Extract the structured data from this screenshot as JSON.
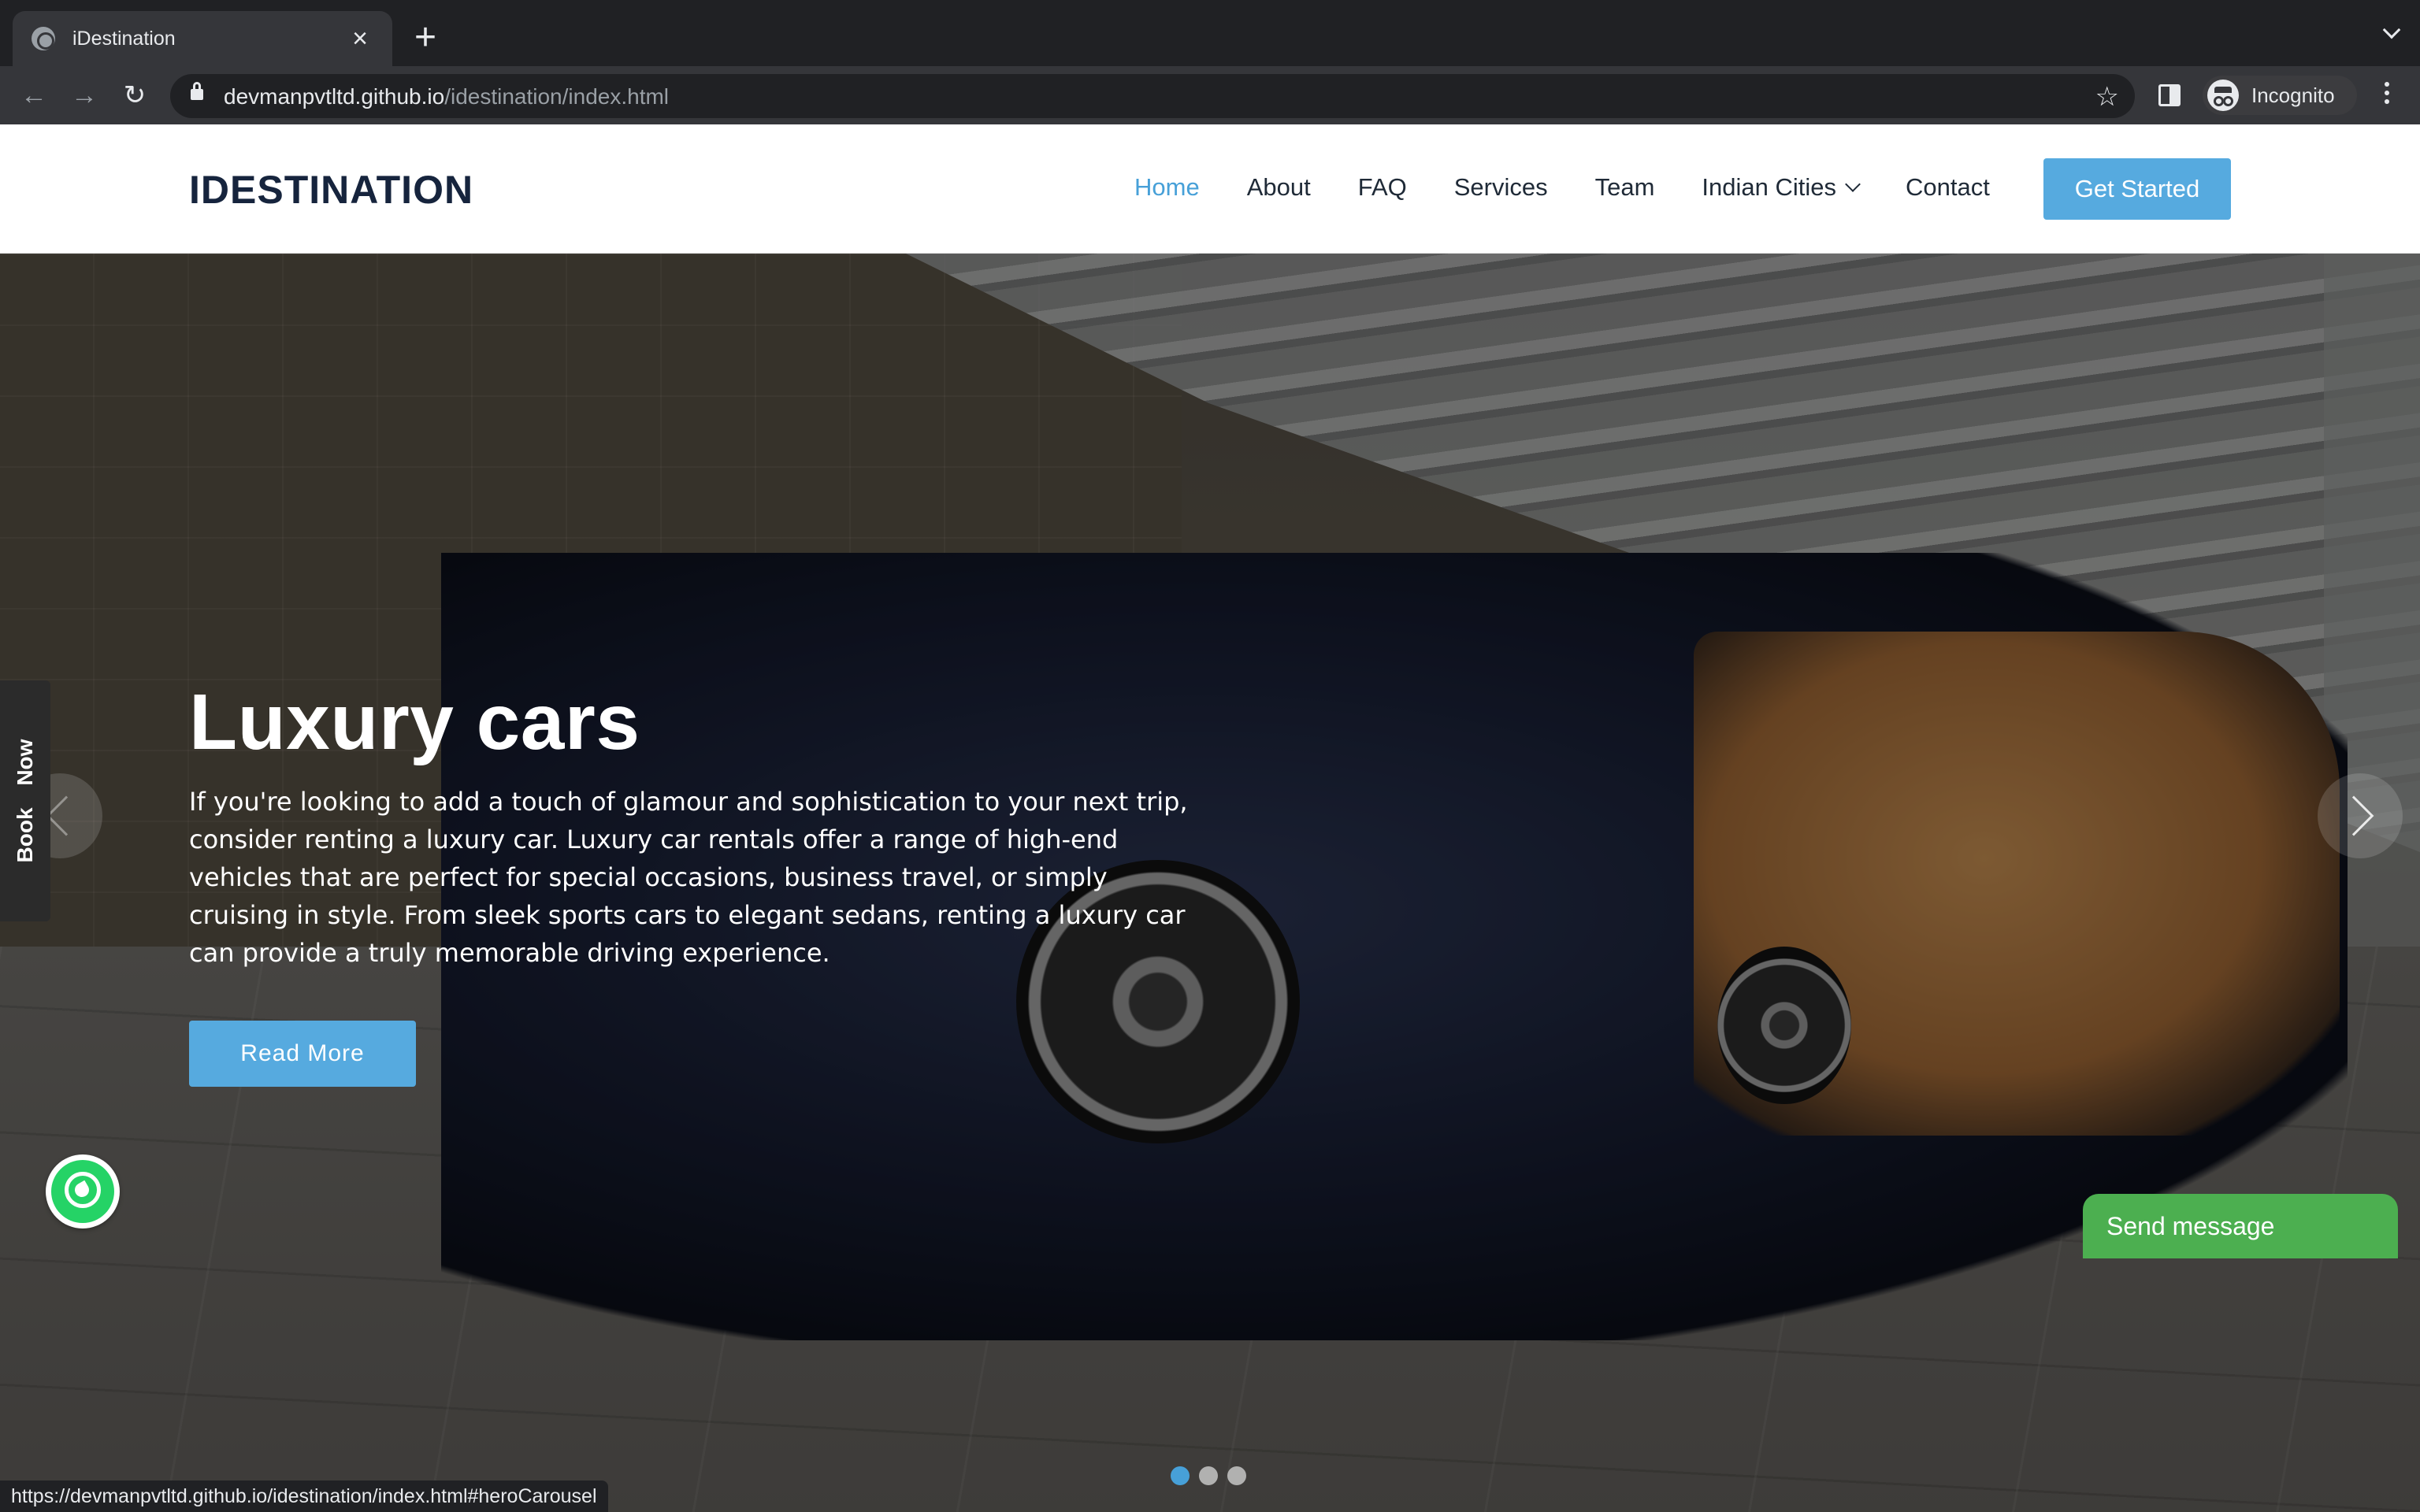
{
  "browser": {
    "tab_title": "iDestination",
    "url_host": "devmanpvtltd.github.io",
    "url_path": "/idestination/index.html",
    "profile_label": "Incognito",
    "status_url": "https://devmanpvtltd.github.io/idestination/index.html#heroCarousel"
  },
  "site": {
    "logo": "IDESTINATION",
    "nav": [
      "Home",
      "About",
      "FAQ",
      "Services",
      "Team",
      "Indian Cities",
      "Contact"
    ],
    "active_nav": "Home",
    "cta_label": "Get Started"
  },
  "hero": {
    "title": "Luxury cars",
    "text": "If you're looking to add a touch of glamour and sophistication to your next trip, consider renting a luxury car. Luxury car rentals offer a range of high-end vehicles that are perfect for special occasions, business travel, or simply cruising in style. From sleek sports cars to elegant sedans, renting a luxury car can provide a truly memorable driving experience.",
    "button_label": "Read More",
    "slide_count": 3,
    "active_slide": 1
  },
  "widgets": {
    "book_now": "Book Now",
    "send_message": "Send message"
  },
  "colors": {
    "accent": "#47a0d8",
    "button": "#56aadf",
    "logo": "#16243d",
    "chat": "#4caf50"
  }
}
